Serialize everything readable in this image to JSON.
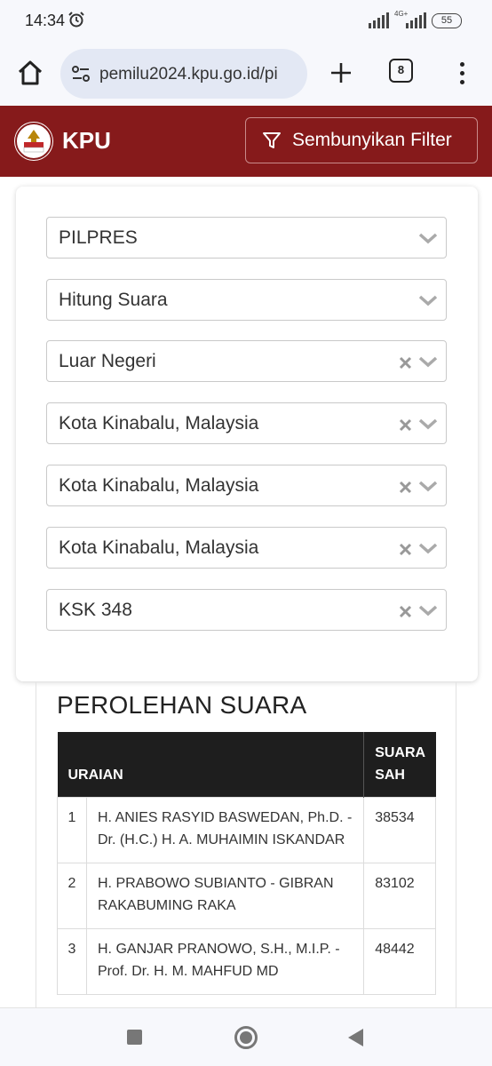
{
  "status_bar": {
    "time": "14:34",
    "network": "4G+",
    "battery": "55",
    "icons": [
      "alarm-icon",
      "signal-icon",
      "battery-icon"
    ]
  },
  "browser": {
    "url": "pemilu2024.kpu.go.id/pi",
    "tab_count": "8",
    "icons": [
      "home-icon",
      "site-settings-icon",
      "plus-icon",
      "more-vert-icon"
    ]
  },
  "header": {
    "title": "KPU",
    "filter_button_label": "Sembunyikan Filter",
    "brand_color": "#861a1b",
    "logo_text": "KOMISI PEMILIHAN UMUM"
  },
  "filters": [
    {
      "value": "PILPRES",
      "clearable": false
    },
    {
      "value": "Hitung Suara",
      "clearable": false
    },
    {
      "value": "Luar Negeri",
      "clearable": true
    },
    {
      "value": "Kota Kinabalu, Malaysia",
      "clearable": true
    },
    {
      "value": "Kota Kinabalu, Malaysia",
      "clearable": true
    },
    {
      "value": "Kota Kinabalu, Malaysia",
      "clearable": true
    },
    {
      "value": "KSK 348",
      "clearable": true
    }
  ],
  "results": {
    "title": "PEROLEHAN SUARA",
    "columns": {
      "no": "",
      "uraian": "URAIAN",
      "suara_sah": "SUARA SAH"
    },
    "rows": [
      {
        "no": "1",
        "name": "H. ANIES RASYID BASWEDAN, Ph.D. - Dr. (H.C.) H. A. MUHAIMIN ISKANDAR",
        "votes": "38534"
      },
      {
        "no": "2",
        "name": "H. PRABOWO SUBIANTO - GIBRAN RAKABUMING RAKA",
        "votes": "83102"
      },
      {
        "no": "3",
        "name": "H. GANJAR PRANOWO, S.H., M.I.P. - Prof. Dr. H. M. MAHFUD MD",
        "votes": "48442"
      }
    ]
  }
}
